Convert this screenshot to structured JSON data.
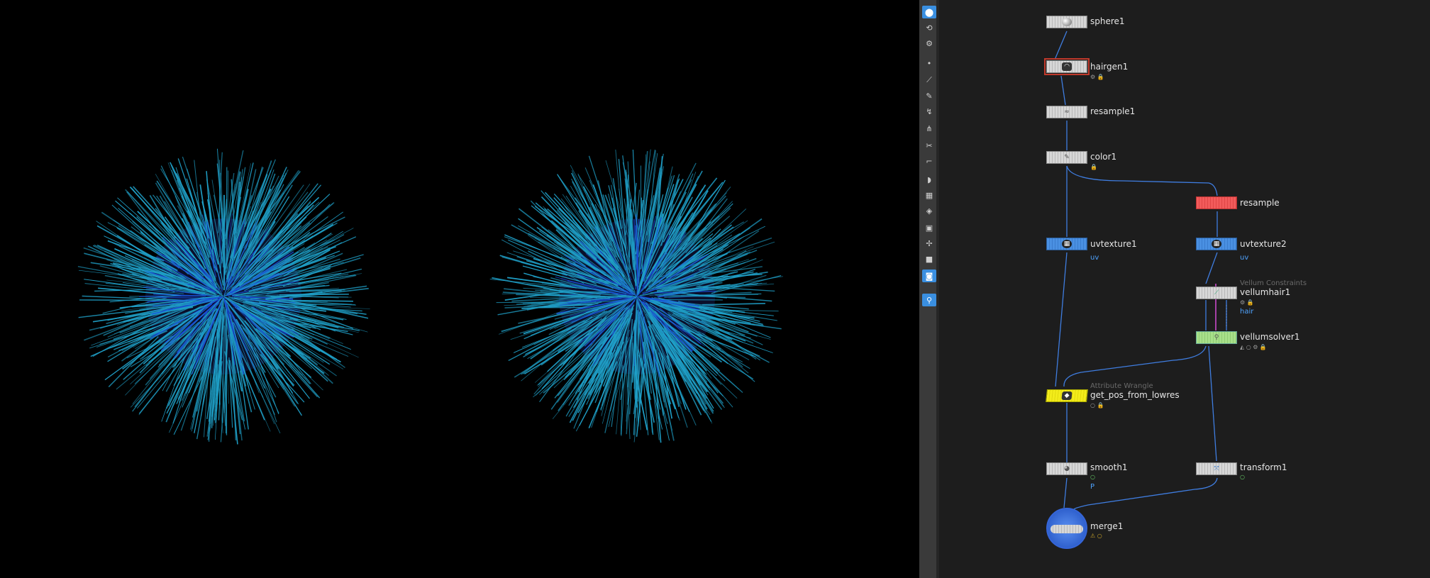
{
  "viewport": {
    "fur_colors": {
      "tip": "#1fa0c8",
      "mid": "#1a4ed8",
      "core": "#0a0f2a"
    },
    "balls": [
      "left-fur-ball",
      "right-fur-ball"
    ]
  },
  "toolbar": {
    "tools": [
      {
        "name": "select-tool",
        "glyph": "⬤",
        "active": true
      },
      {
        "name": "view-tool",
        "glyph": "⟲",
        "active": false
      },
      {
        "name": "handle-tool",
        "glyph": "⚙",
        "active": false
      },
      {
        "name": "point-tool",
        "glyph": "•",
        "active": false
      },
      {
        "name": "brush-tool",
        "glyph": "⟋",
        "active": false
      },
      {
        "name": "pen-tool",
        "glyph": "✎",
        "active": false
      },
      {
        "name": "draw-tool",
        "glyph": "↯",
        "active": false
      },
      {
        "name": "comb-tool",
        "glyph": "⋔",
        "active": false
      },
      {
        "name": "cut-tool",
        "glyph": "✂",
        "active": false
      },
      {
        "name": "guide-tool",
        "glyph": "⌐",
        "active": false
      },
      {
        "name": "sculpt-tool",
        "glyph": "◗",
        "active": false
      },
      {
        "name": "texture-tool",
        "glyph": "▦",
        "active": false
      },
      {
        "name": "camera-tool",
        "glyph": "◈",
        "active": false
      },
      {
        "name": "render-tool",
        "glyph": "▣",
        "active": false
      },
      {
        "name": "snap-tool",
        "glyph": "✢",
        "active": false
      },
      {
        "name": "record-tool",
        "glyph": "■",
        "active": false
      },
      {
        "name": "display-tool",
        "glyph": "◙",
        "active": true
      },
      {
        "name": "pin-tool",
        "glyph": "⚲",
        "active": true
      }
    ]
  },
  "network": {
    "nodes": {
      "sphere1": {
        "label": "sphere1"
      },
      "hairgen1": {
        "label": "hairgen1"
      },
      "resample1": {
        "label": "resample1"
      },
      "color1": {
        "label": "color1"
      },
      "resample": {
        "label": "resample"
      },
      "uvtexture1": {
        "label": "uvtexture1",
        "tag": "uv"
      },
      "uvtexture2": {
        "label": "uvtexture2",
        "tag": "uv"
      },
      "vellumhair1": {
        "label": "vellumhair1",
        "sub": "Vellum Constraints",
        "tag": "hair"
      },
      "vellumsolver1": {
        "label": "vellumsolver1"
      },
      "get_pos_from_lowres": {
        "label": "get_pos_from_lowres",
        "sub": "Attribute Wrangle"
      },
      "smooth1": {
        "label": "smooth1",
        "tag": "P"
      },
      "transform1": {
        "label": "transform1"
      },
      "merge1": {
        "label": "merge1"
      }
    },
    "wire_color": "#3f7de0",
    "constraint_wire_color": "#e050e0"
  }
}
